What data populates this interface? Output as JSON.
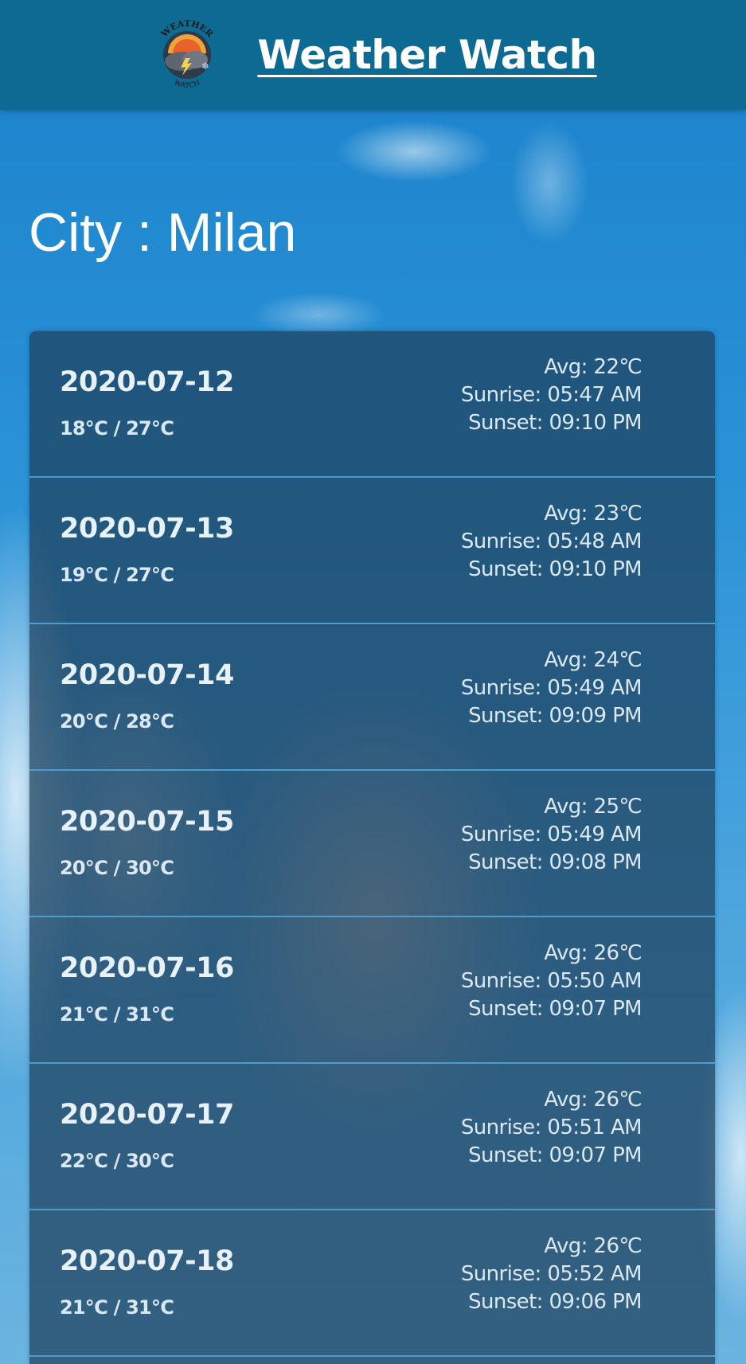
{
  "header": {
    "title": "Weather Watch",
    "logo_text_top": "WEATHER",
    "logo_text_bottom": "WATCH"
  },
  "city_label": "City : Milan",
  "forecast": [
    {
      "date": "2020-07-12",
      "range": "18℃ / 27℃",
      "avg": "Avg: 22℃",
      "sunrise": "Sunrise: 05:47 AM",
      "sunset": "Sunset: 09:10 PM"
    },
    {
      "date": "2020-07-13",
      "range": "19℃ / 27℃",
      "avg": "Avg: 23℃",
      "sunrise": "Sunrise: 05:48 AM",
      "sunset": "Sunset: 09:10 PM"
    },
    {
      "date": "2020-07-14",
      "range": "20℃ / 28℃",
      "avg": "Avg: 24℃",
      "sunrise": "Sunrise: 05:49 AM",
      "sunset": "Sunset: 09:09 PM"
    },
    {
      "date": "2020-07-15",
      "range": "20℃ / 30℃",
      "avg": "Avg: 25℃",
      "sunrise": "Sunrise: 05:49 AM",
      "sunset": "Sunset: 09:08 PM"
    },
    {
      "date": "2020-07-16",
      "range": "21℃ / 31℃",
      "avg": "Avg: 26℃",
      "sunrise": "Sunrise: 05:50 AM",
      "sunset": "Sunset: 09:07 PM"
    },
    {
      "date": "2020-07-17",
      "range": "22℃ / 30℃",
      "avg": "Avg: 26℃",
      "sunrise": "Sunrise: 05:51 AM",
      "sunset": "Sunset: 09:07 PM"
    },
    {
      "date": "2020-07-18",
      "range": "21℃ / 31℃",
      "avg": "Avg: 26℃",
      "sunrise": "Sunrise: 05:52 AM",
      "sunset": "Sunset: 09:06 PM"
    }
  ],
  "colors": {
    "header_bg": "#0d6a92",
    "sky": "#1f88d0",
    "card_bg": "#1e405c",
    "divider": "#4f9ccc"
  }
}
